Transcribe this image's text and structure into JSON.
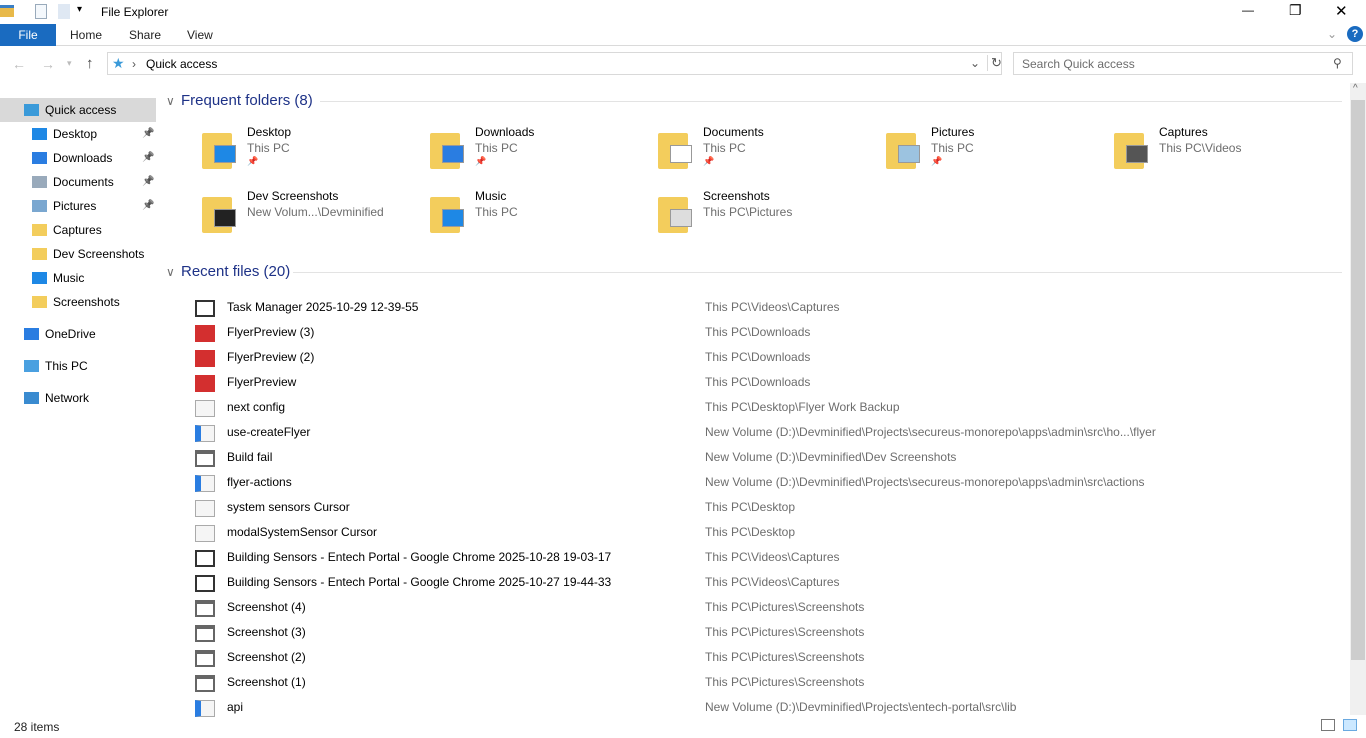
{
  "window": {
    "title": "File Explorer",
    "minimize": "—",
    "restore": "❐",
    "close": "✕",
    "help": "?"
  },
  "ribbon": {
    "tabs": [
      "File",
      "Home",
      "Share",
      "View"
    ]
  },
  "address": {
    "path": "Quick access",
    "search_placeholder": "Search Quick access"
  },
  "nav": [
    {
      "label": "Quick access",
      "icon": "star-icon",
      "selected": true
    },
    {
      "label": "Desktop",
      "icon": "desktop-icon",
      "pinned": true
    },
    {
      "label": "Downloads",
      "icon": "download-icon",
      "pinned": true
    },
    {
      "label": "Documents",
      "icon": "documents-icon",
      "pinned": true
    },
    {
      "label": "Pictures",
      "icon": "pictures-icon",
      "pinned": true
    },
    {
      "label": "Captures",
      "icon": "folder-icon"
    },
    {
      "label": "Dev Screenshots",
      "icon": "folder-icon"
    },
    {
      "label": "Music",
      "icon": "music-icon"
    },
    {
      "label": "Screenshots",
      "icon": "folder-icon"
    },
    {
      "label": "OneDrive",
      "icon": "cloud-icon"
    },
    {
      "label": "This PC",
      "icon": "pc-icon"
    },
    {
      "label": "Network",
      "icon": "network-icon"
    }
  ],
  "frequent": {
    "title": "Frequent folders (8)",
    "items": [
      {
        "name": "Desktop",
        "sub": "This PC",
        "pinned": true,
        "overlay": "#1e88e5"
      },
      {
        "name": "Downloads",
        "sub": "This PC",
        "pinned": true,
        "overlay": "#2a7de1"
      },
      {
        "name": "Documents",
        "sub": "This PC",
        "pinned": true,
        "overlay": "#ffffff"
      },
      {
        "name": "Pictures",
        "sub": "This PC",
        "pinned": true,
        "overlay": "#9cc3e0"
      },
      {
        "name": "Captures",
        "sub": "This PC\\Videos",
        "pinned": false,
        "overlay": "#555555"
      },
      {
        "name": "Dev Screenshots",
        "sub": "New Volum...\\Devminified",
        "pinned": false,
        "overlay": "#222222"
      },
      {
        "name": "Music",
        "sub": "This PC",
        "pinned": false,
        "overlay": "#1e88e5"
      },
      {
        "name": "Screenshots",
        "sub": "This PC\\Pictures",
        "pinned": false,
        "overlay": "#dddddd"
      }
    ]
  },
  "recent": {
    "title": "Recent files (20)",
    "items": [
      {
        "name": "Task Manager 2025-10-29 12-39-55",
        "path": "This PC\\Videos\\Captures",
        "icon": "video"
      },
      {
        "name": "FlyerPreview (3)",
        "path": "This PC\\Downloads",
        "icon": "pdf"
      },
      {
        "name": "FlyerPreview (2)",
        "path": "This PC\\Downloads",
        "icon": "pdf"
      },
      {
        "name": "FlyerPreview",
        "path": "This PC\\Downloads",
        "icon": "pdf"
      },
      {
        "name": "next config",
        "path": "This PC\\Desktop\\Flyer Work Backup",
        "icon": "file"
      },
      {
        "name": "use-createFlyer",
        "path": "New Volume (D:)\\Devminified\\Projects\\secureus-monorepo\\apps\\admin\\src\\ho...\\flyer",
        "icon": "code"
      },
      {
        "name": "Build fail",
        "path": "New Volume (D:)\\Devminified\\Dev Screenshots",
        "icon": "image"
      },
      {
        "name": "flyer-actions",
        "path": "New Volume (D:)\\Devminified\\Projects\\secureus-monorepo\\apps\\admin\\src\\actions",
        "icon": "code"
      },
      {
        "name": "system sensors Cursor",
        "path": "This PC\\Desktop",
        "icon": "file"
      },
      {
        "name": "modalSystemSensor Cursor",
        "path": "This PC\\Desktop",
        "icon": "file"
      },
      {
        "name": "Building Sensors - Entech Portal - Google Chrome 2025-10-28 19-03-17",
        "path": "This PC\\Videos\\Captures",
        "icon": "video"
      },
      {
        "name": "Building Sensors - Entech Portal - Google Chrome 2025-10-27 19-44-33",
        "path": "This PC\\Videos\\Captures",
        "icon": "video"
      },
      {
        "name": "Screenshot (4)",
        "path": "This PC\\Pictures\\Screenshots",
        "icon": "image"
      },
      {
        "name": "Screenshot (3)",
        "path": "This PC\\Pictures\\Screenshots",
        "icon": "image"
      },
      {
        "name": "Screenshot (2)",
        "path": "This PC\\Pictures\\Screenshots",
        "icon": "image"
      },
      {
        "name": "Screenshot (1)",
        "path": "This PC\\Pictures\\Screenshots",
        "icon": "image"
      },
      {
        "name": "api",
        "path": "New Volume (D:)\\Devminified\\Projects\\entech-portal\\src\\lib",
        "icon": "code"
      }
    ]
  },
  "status": {
    "items": "28 items"
  }
}
